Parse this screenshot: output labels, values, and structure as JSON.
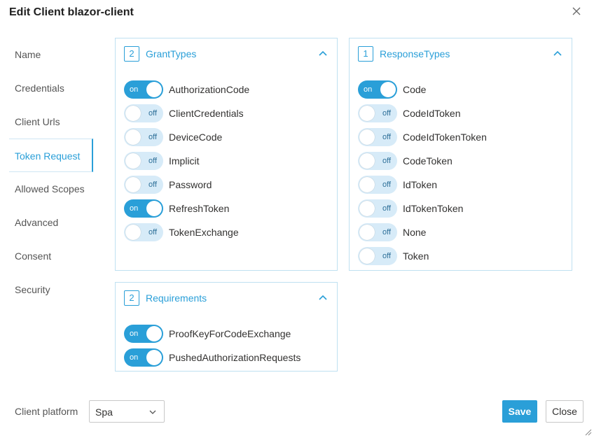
{
  "dialog": {
    "title": "Edit Client blazor-client"
  },
  "nav": {
    "items": [
      {
        "label": "Name"
      },
      {
        "label": "Credentials"
      },
      {
        "label": "Client Urls"
      },
      {
        "label": "Token Request"
      },
      {
        "label": "Allowed Scopes"
      },
      {
        "label": "Advanced"
      },
      {
        "label": "Consent"
      },
      {
        "label": "Security"
      }
    ],
    "active": "Token Request"
  },
  "grant_types": {
    "count": "2",
    "title": "GrantTypes",
    "items": [
      {
        "label": "AuthorizationCode",
        "state": "on"
      },
      {
        "label": "ClientCredentials",
        "state": "off"
      },
      {
        "label": "DeviceCode",
        "state": "off"
      },
      {
        "label": "Implicit",
        "state": "off"
      },
      {
        "label": "Password",
        "state": "off"
      },
      {
        "label": "RefreshToken",
        "state": "on"
      },
      {
        "label": "TokenExchange",
        "state": "off"
      }
    ]
  },
  "response_types": {
    "count": "1",
    "title": "ResponseTypes",
    "items": [
      {
        "label": "Code",
        "state": "on"
      },
      {
        "label": "CodeIdToken",
        "state": "off"
      },
      {
        "label": "CodeIdTokenToken",
        "state": "off"
      },
      {
        "label": "CodeToken",
        "state": "off"
      },
      {
        "label": "IdToken",
        "state": "off"
      },
      {
        "label": "IdTokenToken",
        "state": "off"
      },
      {
        "label": "None",
        "state": "off"
      },
      {
        "label": "Token",
        "state": "off"
      }
    ]
  },
  "requirements": {
    "count": "2",
    "title": "Requirements",
    "items": [
      {
        "label": "ProofKeyForCodeExchange",
        "state": "on"
      },
      {
        "label": "PushedAuthorizationRequests",
        "state": "on"
      }
    ]
  },
  "footer": {
    "platform_label": "Client platform",
    "platform_value": "Spa",
    "save_label": "Save",
    "close_label": "Close"
  },
  "colors": {
    "accent": "#2a9fd8",
    "toggle_off": "#d7ebf8",
    "panel_border": "#bfe0f1"
  },
  "icons": {
    "close": "close-icon",
    "collapse": "chevron-up-icon",
    "dropdown": "chevron-down-icon",
    "resize": "resize-grip-icon"
  }
}
